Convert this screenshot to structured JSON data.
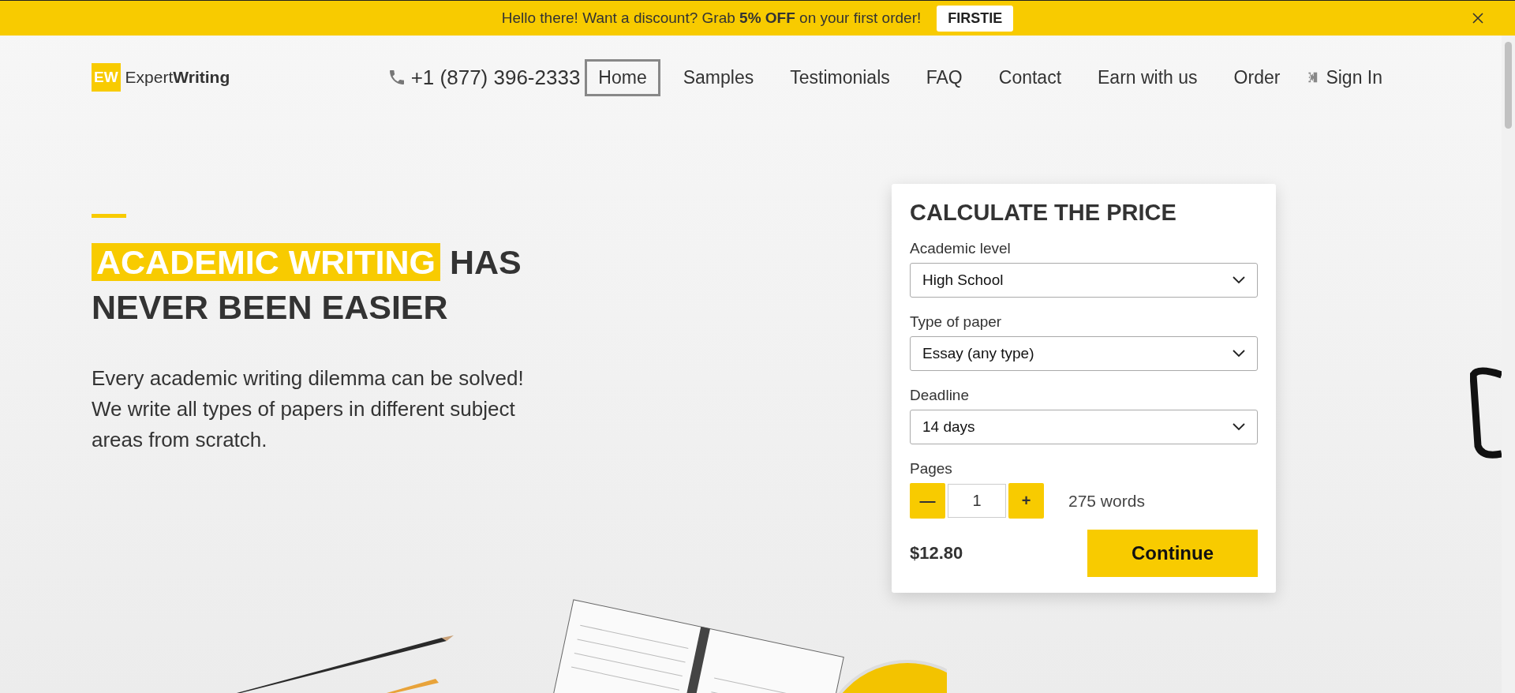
{
  "promo_bar": {
    "text": "Hello there! Want a discount? Grab **5% OFF** on your first order!",
    "code": "FIRSTIE"
  },
  "header": {
    "logo_mark": "EW",
    "logo_text_light": "Expert",
    "logo_text_bold": "Writing",
    "phone": "+1 (877) 396-2333",
    "nav": [
      {
        "label": "Home",
        "selected": true
      },
      {
        "label": "Samples",
        "selected": false
      },
      {
        "label": "Testimonials",
        "selected": false
      },
      {
        "label": "FAQ",
        "selected": false
      },
      {
        "label": "Contact",
        "selected": false
      },
      {
        "label": "Earn with us",
        "selected": false
      },
      {
        "label": "Order",
        "selected": false
      }
    ],
    "sign_in": "Sign In"
  },
  "hero": {
    "highlight": "ACADEMIC WRITING",
    "title_rest_1": "HAS",
    "title_line_2": "NEVER BEEN EASIER",
    "description": "Every academic writing dilemma can be solved! We write all types of papers in different subject areas from scratch."
  },
  "calculator": {
    "title": "CALCULATE THE PRICE",
    "selects": [
      {
        "label": "Academic level",
        "value": "High School"
      },
      {
        "label": "Type of paper",
        "value": "Essay (any type)"
      },
      {
        "label": "Deadline",
        "value": "14 days"
      }
    ],
    "pages_label": "Pages",
    "decrement": "—",
    "pages": "1",
    "increment": "+",
    "words": "275 words",
    "price": "$12.80",
    "continue": "Continue"
  }
}
